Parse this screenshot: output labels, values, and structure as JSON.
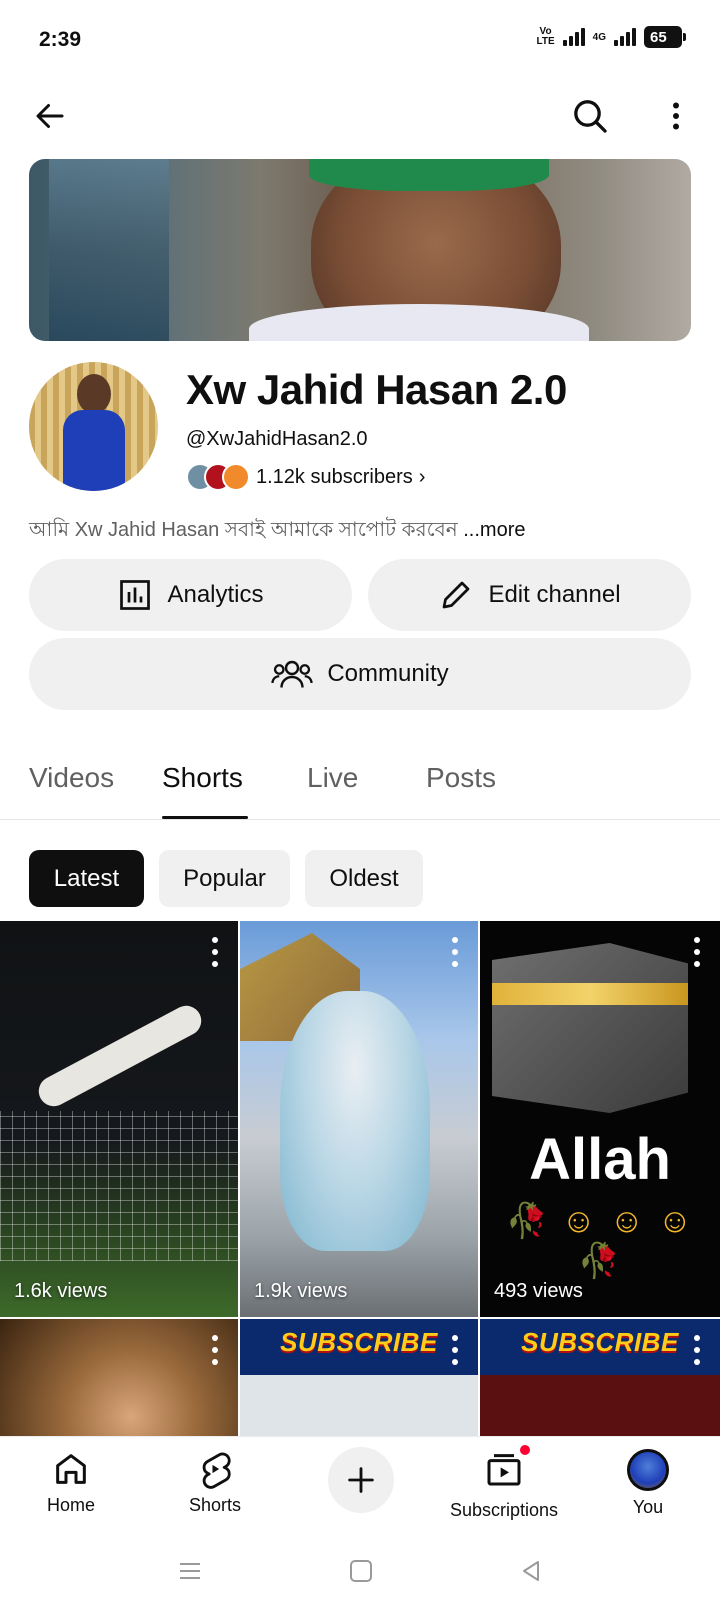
{
  "status_bar": {
    "time": "2:39",
    "volte": "Vo\nLTE",
    "network": "4G",
    "battery": "65"
  },
  "top_bar": {
    "back_icon": "arrow-left-icon",
    "search_icon": "search-icon",
    "menu_icon": "more-vertical-icon"
  },
  "channel": {
    "name": "Xw Jahid Hasan 2.0",
    "handle": "@XwJahidHasan2.0",
    "subscribers": "1.12k subscribers",
    "subscribers_chevron": "›",
    "description": "আমি Xw Jahid Hasan সবাই আমাকে সাপোট করবেন ",
    "more_label": "...more"
  },
  "actions": {
    "analytics_label": "Analytics",
    "edit_channel_label": "Edit channel",
    "community_label": "Community"
  },
  "tabs": [
    {
      "label": "Videos",
      "active": false
    },
    {
      "label": "Shorts",
      "active": true
    },
    {
      "label": "Live",
      "active": false
    },
    {
      "label": "Posts",
      "active": false
    }
  ],
  "chips": [
    {
      "label": "Latest",
      "selected": true
    },
    {
      "label": "Popular",
      "selected": false
    },
    {
      "label": "Oldest",
      "selected": false
    }
  ],
  "shorts": [
    {
      "views": "1.6k views"
    },
    {
      "views": "1.9k views"
    },
    {
      "views": "493 views",
      "overlay_text": "Allah",
      "emoji_row": "🥀 ☺ ☺ ☺ 🥀"
    },
    {
      "views": ""
    },
    {
      "views": "",
      "overlay_text": "SUBSCRIBE"
    },
    {
      "views": "",
      "overlay_text": "SUBSCRIBE"
    }
  ],
  "bottom_nav": [
    {
      "label": "Home",
      "icon": "home-icon"
    },
    {
      "label": "Shorts",
      "icon": "shorts-icon"
    },
    {
      "label": "",
      "icon": "create-icon"
    },
    {
      "label": "Subscriptions",
      "icon": "subscriptions-icon"
    },
    {
      "label": "You",
      "icon": "avatar"
    }
  ],
  "colors": {
    "accent_red": "#ff0033",
    "chip_selected": "#0f0f0f",
    "pill_bg": "#f0f0f0"
  }
}
